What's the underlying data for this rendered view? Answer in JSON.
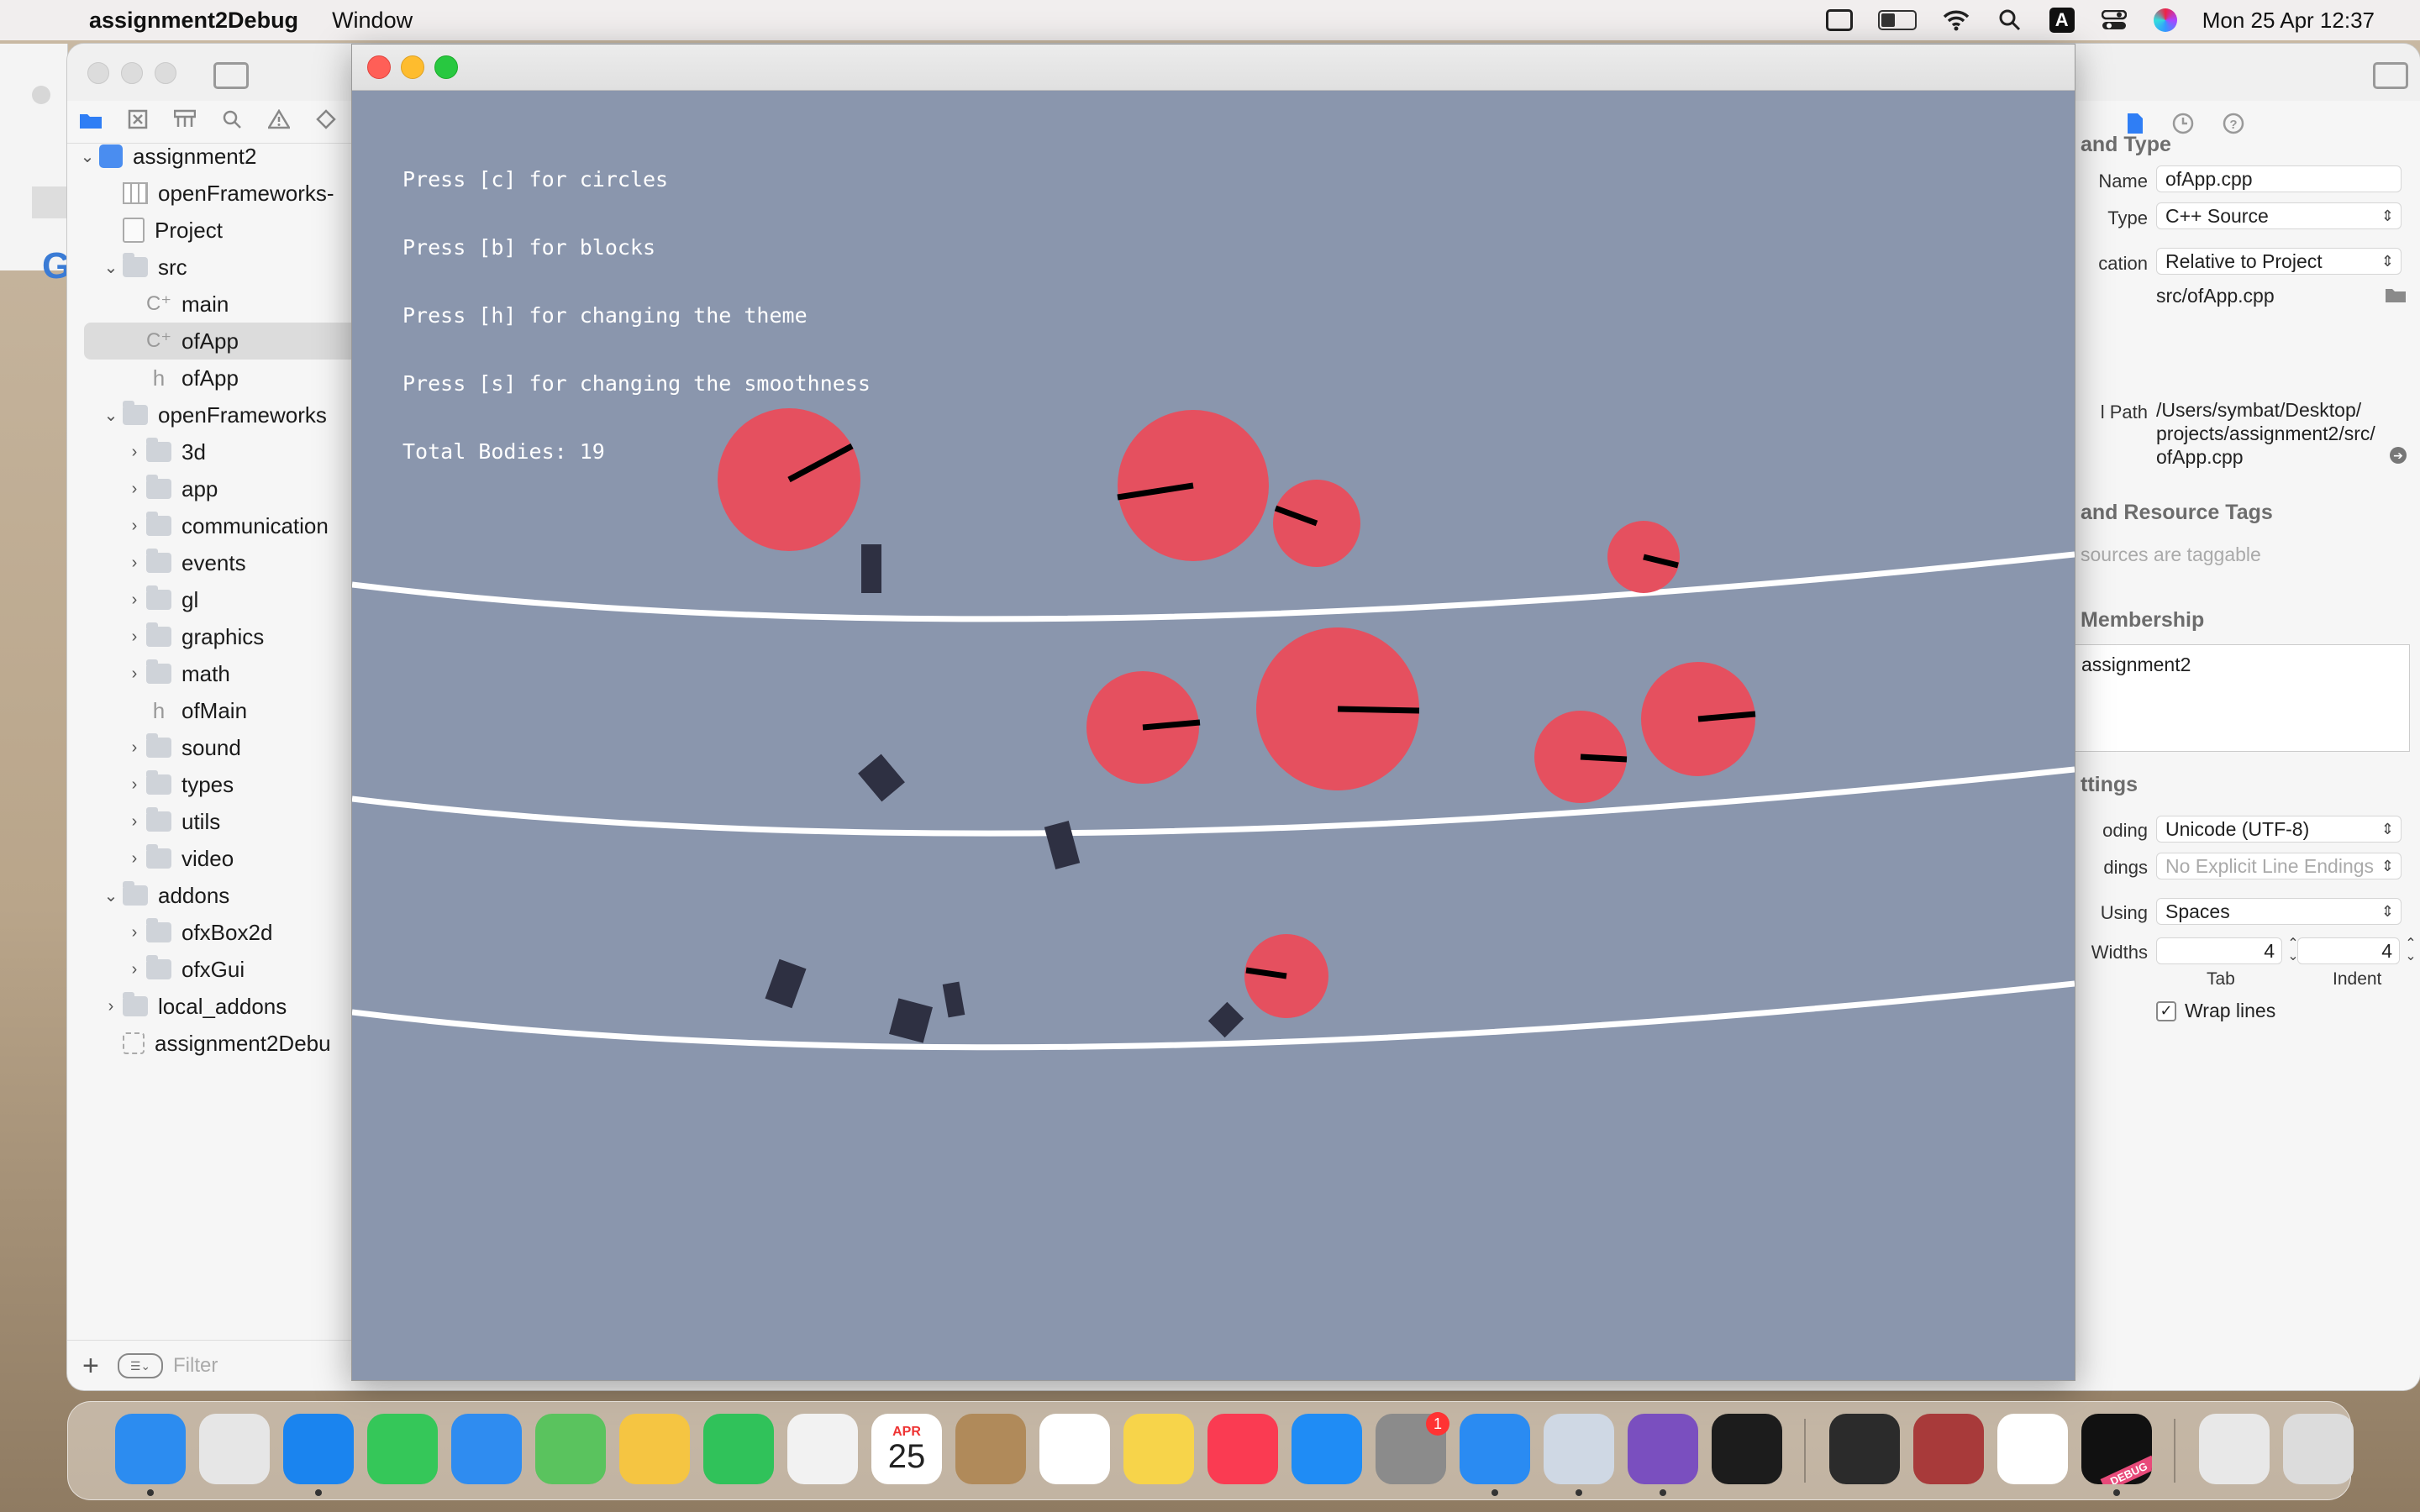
{
  "menubar": {
    "app_name": "assignment2Debug",
    "menu_window": "Window",
    "input_source": "A",
    "clock": "Mon 25 Apr  12:37"
  },
  "navigator": {
    "items": [
      {
        "label": "assignment2",
        "icon": "project-icon",
        "indent": 0,
        "chevron": "open"
      },
      {
        "label": "openFrameworks-",
        "icon": "grid-file-icon",
        "indent": 1,
        "chevron": ""
      },
      {
        "label": "Project",
        "icon": "document-icon",
        "indent": 1,
        "chevron": ""
      },
      {
        "label": "src",
        "icon": "folder-icon",
        "indent": 1,
        "chevron": "open"
      },
      {
        "label": "main",
        "icon": "cpp-file-icon",
        "indent": 2,
        "chevron": ""
      },
      {
        "label": "ofApp",
        "icon": "cpp-file-icon",
        "indent": 2,
        "chevron": "",
        "selected": true
      },
      {
        "label": "ofApp",
        "icon": "header-file-icon",
        "indent": 2,
        "chevron": ""
      },
      {
        "label": "openFrameworks",
        "icon": "folder-icon",
        "indent": 1,
        "chevron": "open"
      },
      {
        "label": "3d",
        "icon": "folder-icon",
        "indent": 2,
        "chevron": "closed"
      },
      {
        "label": "app",
        "icon": "folder-icon",
        "indent": 2,
        "chevron": "closed"
      },
      {
        "label": "communication",
        "icon": "folder-icon",
        "indent": 2,
        "chevron": "closed"
      },
      {
        "label": "events",
        "icon": "folder-icon",
        "indent": 2,
        "chevron": "closed"
      },
      {
        "label": "gl",
        "icon": "folder-icon",
        "indent": 2,
        "chevron": "closed"
      },
      {
        "label": "graphics",
        "icon": "folder-icon",
        "indent": 2,
        "chevron": "closed"
      },
      {
        "label": "math",
        "icon": "folder-icon",
        "indent": 2,
        "chevron": "closed"
      },
      {
        "label": "ofMain",
        "icon": "header-file-icon",
        "indent": 2,
        "chevron": ""
      },
      {
        "label": "sound",
        "icon": "folder-icon",
        "indent": 2,
        "chevron": "closed"
      },
      {
        "label": "types",
        "icon": "folder-icon",
        "indent": 2,
        "chevron": "closed"
      },
      {
        "label": "utils",
        "icon": "folder-icon",
        "indent": 2,
        "chevron": "closed"
      },
      {
        "label": "video",
        "icon": "folder-icon",
        "indent": 2,
        "chevron": "closed"
      },
      {
        "label": "addons",
        "icon": "folder-icon",
        "indent": 1,
        "chevron": "open"
      },
      {
        "label": "ofxBox2d",
        "icon": "folder-icon",
        "indent": 2,
        "chevron": "closed"
      },
      {
        "label": "ofxGui",
        "icon": "folder-icon",
        "indent": 2,
        "chevron": "closed"
      },
      {
        "label": "local_addons",
        "icon": "folder-icon",
        "indent": 1,
        "chevron": "closed"
      },
      {
        "label": "assignment2Debu",
        "icon": "target-icon",
        "indent": 1,
        "chevron": ""
      }
    ],
    "filter_placeholder": "Filter"
  },
  "inspector": {
    "identity_heading": "and Type",
    "name_label": "Name",
    "name_value": "ofApp.cpp",
    "type_label": "Type",
    "type_value": "C++ Source",
    "location_label": "cation",
    "location_value": "Relative to Project",
    "relative_path": "src/ofApp.cpp",
    "fullpath_label": "l Path",
    "fullpath_lines": [
      "/Users/symbat/Desktop/",
      "projects/assignment2/src/",
      "ofApp.cpp"
    ],
    "tags_heading": "and Resource Tags",
    "tags_placeholder": "sources are taggable",
    "membership_heading": "Membership",
    "membership_target": "assignment2",
    "settings_heading": "ttings",
    "encoding_label": "oding",
    "encoding_value": "Unicode (UTF-8)",
    "endings_label": "dings",
    "endings_value": "No Explicit Line Endings",
    "indent_using_label": "Using",
    "indent_using_value": "Spaces",
    "widths_label": "Widths",
    "tab_width": "4",
    "indent_width": "4",
    "tab_label": "Tab",
    "indent_label": "Indent",
    "wrap_lines_label": "Wrap lines",
    "wrap_lines_checked": true
  },
  "app": {
    "instructions": [
      "Press [c] for circles",
      "Press [b] for blocks",
      "Press [h] for changing the theme",
      "Press [s] for changing the smoothness",
      "Total Bodies: 19"
    ],
    "colors": {
      "background": "#8a96ad",
      "circle": "#e5505f",
      "block": "#2e3042",
      "ground": "#ffffff"
    }
  },
  "dock": {
    "items": [
      {
        "name": "finder-icon",
        "color": "#2c8cf0",
        "running": true
      },
      {
        "name": "launchpad-icon",
        "color": "#e6e6e6",
        "running": false
      },
      {
        "name": "safari-icon",
        "color": "#1a84ef",
        "running": true
      },
      {
        "name": "messages-icon",
        "color": "#35c759",
        "running": false
      },
      {
        "name": "mail-icon",
        "color": "#2f8cf0",
        "running": false
      },
      {
        "name": "maps-icon",
        "color": "#5ac35e",
        "running": false
      },
      {
        "name": "photos-icon",
        "color": "#f5c542",
        "running": false
      },
      {
        "name": "facetime-icon",
        "color": "#30c25a",
        "running": false
      },
      {
        "name": "chrome-icon",
        "color": "#f2f2f2",
        "running": false
      },
      {
        "name": "calendar-icon",
        "color": "#ffffff",
        "running": false,
        "month": "APR",
        "day": "25"
      },
      {
        "name": "contacts-icon",
        "color": "#b08a5a",
        "running": false
      },
      {
        "name": "reminders-icon",
        "color": "#ffffff",
        "running": false
      },
      {
        "name": "notes-icon",
        "color": "#f7d44a",
        "running": false
      },
      {
        "name": "music-icon",
        "color": "#fa3b52",
        "running": false
      },
      {
        "name": "app-store-icon",
        "color": "#1f8cf5",
        "running": false
      },
      {
        "name": "system-preferences-icon",
        "color": "#8b8b8b",
        "running": false,
        "badge": "1"
      },
      {
        "name": "xcode-icon",
        "color": "#2a8bf2",
        "running": true
      },
      {
        "name": "preview-icon",
        "color": "#cfd8e4",
        "running": true
      },
      {
        "name": "github-desktop-icon",
        "color": "#7a4fbf",
        "running": true
      },
      {
        "name": "terminal-icon",
        "color": "#1c1c1c",
        "running": false
      },
      {
        "name": "quicktime-icon",
        "color": "#2b2b2b",
        "running": false
      },
      {
        "name": "dictionary-icon",
        "color": "#a83a3a",
        "running": false
      },
      {
        "name": "word-icon",
        "color": "#ffffff",
        "running": false
      },
      {
        "name": "assignment2-debug-icon",
        "color": "#111111",
        "running": true,
        "ribbon": "DEBUG"
      },
      {
        "name": "window-preview-icon",
        "color": "#e8e8e8",
        "running": false
      },
      {
        "name": "trash-icon",
        "color": "#dcdcdc",
        "running": false
      }
    ]
  }
}
